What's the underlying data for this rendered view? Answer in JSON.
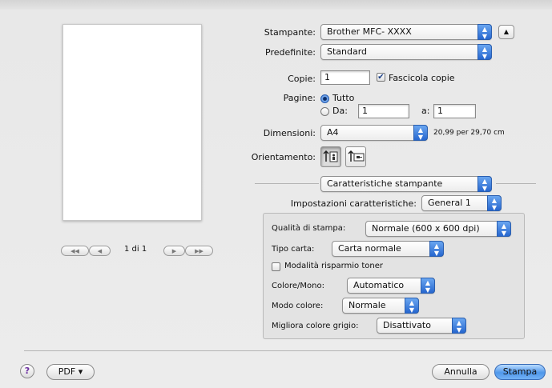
{
  "preview": {
    "page_indicator": "1 di 1"
  },
  "printer": {
    "label": "Stampante:",
    "value": "Brother MFC- XXXX"
  },
  "presets": {
    "label": "Predefinite:",
    "value": "Standard"
  },
  "copies": {
    "label": "Copie:",
    "value": "1",
    "collate_label": "Fascicola copie",
    "collate_checked": true
  },
  "pages": {
    "label": "Pagine:",
    "all_label": "Tutto",
    "from_label": "Da:",
    "from_value": "1",
    "to_label": "a:",
    "to_value": "1",
    "selected": "all"
  },
  "paper_size": {
    "label": "Dimensioni:",
    "value": "A4",
    "dims": "20,99 per 29,70 cm"
  },
  "orientation": {
    "label": "Orientamento:",
    "selected": "portrait"
  },
  "panel": {
    "value": "Caratteristiche stampante"
  },
  "feature_sets": {
    "label": "Impostazioni caratteristiche:",
    "value": "General 1"
  },
  "settings": {
    "quality": {
      "label": "Qualità di stampa:",
      "value": "Normale (600 x 600 dpi)"
    },
    "media": {
      "label": "Tipo carta:",
      "value": "Carta normale"
    },
    "toner_save": {
      "label": "Modalità risparmio toner",
      "checked": false
    },
    "color_mono": {
      "label": "Colore/Mono:",
      "value": "Automatico"
    },
    "color_mode": {
      "label": "Modo colore:",
      "value": "Normale"
    },
    "gray": {
      "label": "Migliora colore grigio:",
      "value": "Disattivato"
    }
  },
  "footer": {
    "help": "?",
    "pdf": "PDF ▾",
    "cancel": "Annulla",
    "print": "Stampa"
  },
  "colors": {
    "accent": "#2f6cd3",
    "panel": "#e3e3e3"
  }
}
